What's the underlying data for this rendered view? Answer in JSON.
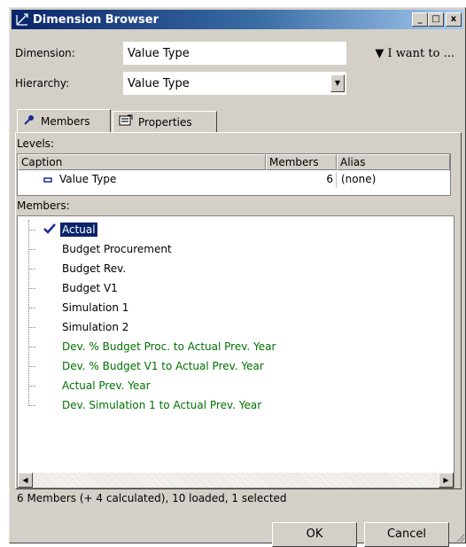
{
  "window": {
    "title": "Dimension Browser",
    "controls": {
      "minimize": "_",
      "maximize": "□",
      "close": "x"
    }
  },
  "dimension": {
    "label": "Dimension:",
    "value": "Value Type"
  },
  "hierarchy": {
    "label": "Hierarchy:",
    "value": "Value Type"
  },
  "i_want_to": "▼ I want to ...",
  "tabs": [
    {
      "label": "Members",
      "active": true
    },
    {
      "label": "Properties",
      "active": false
    }
  ],
  "levels": {
    "label": "Levels:",
    "columns": [
      "Caption",
      "Members",
      "Alias"
    ],
    "rows": [
      {
        "caption": "Value Type",
        "members": "6",
        "alias": "(none)"
      }
    ]
  },
  "members": {
    "label": "Members:",
    "items": [
      {
        "label": "Actual",
        "color": "#000000",
        "selected": true
      },
      {
        "label": "Budget Procurement",
        "color": "#000000",
        "selected": false
      },
      {
        "label": "Budget Rev.",
        "color": "#000000",
        "selected": false
      },
      {
        "label": "Budget V1",
        "color": "#000000",
        "selected": false
      },
      {
        "label": "Simulation 1",
        "color": "#000000",
        "selected": false
      },
      {
        "label": "Simulation 2",
        "color": "#000000",
        "selected": false
      },
      {
        "label": "Dev. % Budget Proc. to Actual Prev. Year",
        "color": "#007000",
        "selected": false
      },
      {
        "label": "Dev. % Budget V1 to Actual Prev. Year",
        "color": "#007000",
        "selected": false
      },
      {
        "label": "Actual Prev. Year",
        "color": "#007000",
        "selected": false
      },
      {
        "label": "Dev. Simulation 1 to Actual Prev. Year",
        "color": "#007000",
        "selected": false
      }
    ]
  },
  "status": "6 Members (+ 4 calculated), 10 loaded, 1 selected",
  "buttons": {
    "ok": "OK",
    "cancel": "Cancel"
  },
  "colors": {
    "title_bar": "#0a246a",
    "selection": "#0a246a",
    "calculated_text": "#007000",
    "window_bg": "#d4d0c8"
  }
}
